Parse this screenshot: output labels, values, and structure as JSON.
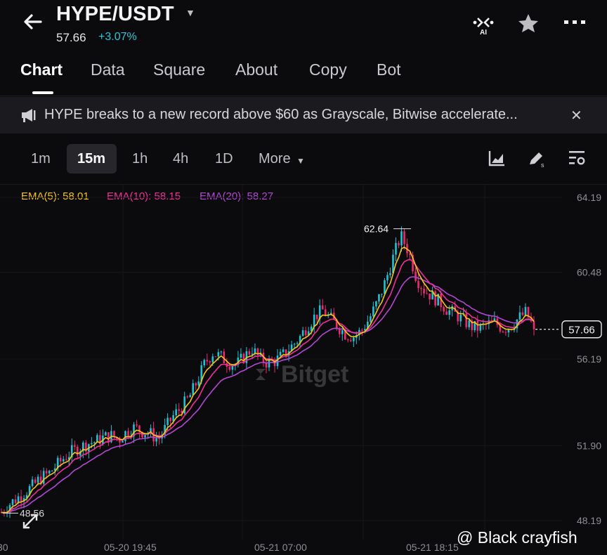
{
  "header": {
    "pair": "HYPE/USDT",
    "price": "57.66",
    "change": "+3.07%",
    "ai_label": "AI"
  },
  "tabs": [
    "Chart",
    "Data",
    "Square",
    "About",
    "Copy",
    "Bot"
  ],
  "news": {
    "text": "HYPE breaks to a new record above $60 as Grayscale, Bitwise accelerate..."
  },
  "intervals": [
    "1m",
    "15m",
    "1h",
    "4h",
    "1D",
    "More"
  ],
  "selected_interval": "15m",
  "ema": {
    "ema5": "EMA(5): 58.01",
    "ema10": "EMA(10): 58.15",
    "ema20": "EMA(20): 58.27"
  },
  "colors": {
    "up": "#22c1d6",
    "down": "#f0286f",
    "ema5": "#f5c518",
    "ema10": "#f0309a",
    "ema20": "#b248d6"
  },
  "chart_data": {
    "type": "candlestick",
    "y_ticks": [
      "64.19",
      "60.48",
      "56.19",
      "51.90",
      "48.19"
    ],
    "x_ticks": [
      "30",
      "05-20 19:45",
      "05-21 07:00",
      "05-21 18:15"
    ],
    "high_label": "62.64",
    "low_label": "48.56",
    "last_price": "57.66",
    "ylim": [
      48.19,
      64.19
    ],
    "close_path": [
      48.6,
      49.0,
      49.3,
      49.6,
      49.9,
      50.3,
      50.5,
      50.9,
      51.3,
      51.6,
      51.8,
      52.0,
      52.1,
      52.3,
      52.4,
      52.2,
      52.6,
      52.8,
      52.6,
      52.5,
      52.2,
      52.8,
      53.4,
      53.8,
      54.3,
      55.1,
      56.0,
      56.5,
      56.3,
      56.0,
      55.9,
      56.3,
      56.7,
      56.2,
      56.0,
      56.1,
      56.4,
      56.8,
      57.2,
      57.8,
      58.3,
      58.6,
      58.2,
      57.8,
      57.4,
      57.3,
      57.6,
      58.2,
      59.0,
      60.0,
      61.2,
      62.3,
      61.5,
      60.2,
      59.6,
      59.3,
      59.0,
      58.6,
      58.4,
      58.1,
      57.8,
      57.7,
      57.9,
      58.0,
      57.7,
      57.8,
      58.2,
      58.5,
      57.66
    ]
  },
  "watermark": "@ Black crayfish"
}
